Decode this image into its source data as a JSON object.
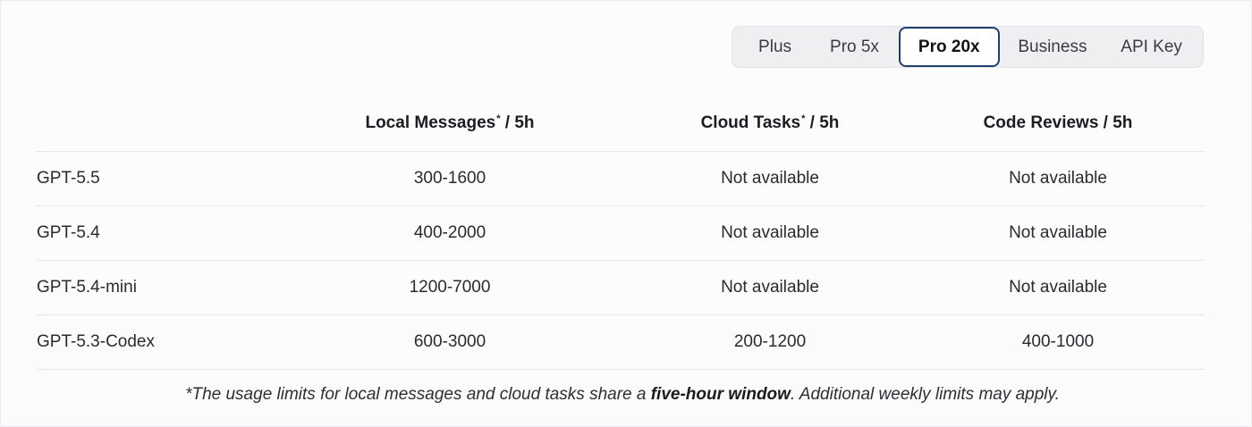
{
  "plan_tabs": {
    "items": [
      {
        "label": "Plus"
      },
      {
        "label": "Pro 5x"
      },
      {
        "label": "Pro 20x"
      },
      {
        "label": "Business"
      },
      {
        "label": "API Key"
      }
    ],
    "selected": "Pro 20x"
  },
  "table": {
    "headers": {
      "local": "Local Messages",
      "local_suffix": " / 5h",
      "cloud": "Cloud Tasks",
      "cloud_suffix": " / 5h",
      "review": "Code Reviews / 5h",
      "star": "*"
    },
    "rows": [
      {
        "model": "GPT-5.5",
        "local": "300-1600",
        "cloud": "Not available",
        "review": "Not available"
      },
      {
        "model": "GPT-5.4",
        "local": "400-2000",
        "cloud": "Not available",
        "review": "Not available"
      },
      {
        "model": "GPT-5.4-mini",
        "local": "1200-7000",
        "cloud": "Not available",
        "review": "Not available"
      },
      {
        "model": "GPT-5.3-Codex",
        "local": "600-3000",
        "cloud": "200-1200",
        "review": "400-1000"
      }
    ]
  },
  "footnote": {
    "before": "*The usage limits for local messages and cloud tasks share a ",
    "bold": "five-hour window",
    "after": ". Additional weekly limits may apply."
  },
  "colors": {
    "active_tab_border": "#1f3f6e",
    "tab_bar_bg": "#efeff2",
    "divider": "#e6e6ea"
  }
}
